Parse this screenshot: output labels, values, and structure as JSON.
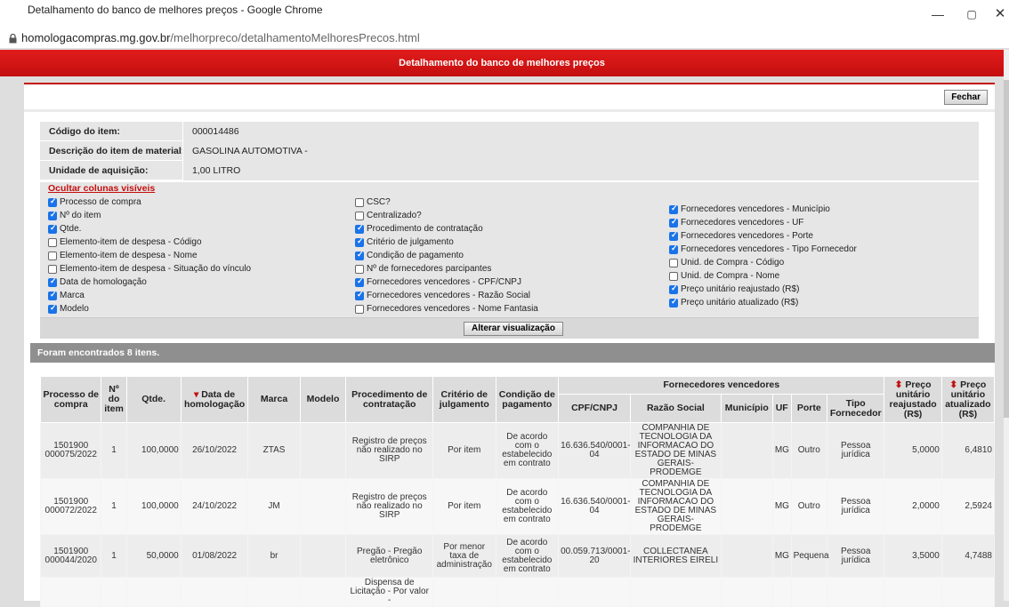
{
  "window": {
    "title": "Detalhamento do banco de melhores preços - Google Chrome",
    "min": "—",
    "max": "▢",
    "close": "✕"
  },
  "url": {
    "host": "homologacompras.mg.gov.br",
    "path": "/melhorpreco/detalhamentoMelhoresPrecos.html"
  },
  "header": {
    "title": "Detalhamento do banco de melhores preços",
    "close_label": "Fechar"
  },
  "info": [
    {
      "label": "Código do item:",
      "value": "000014486"
    },
    {
      "label": "Descrição do item de material:",
      "value": "GASOLINA AUTOMOTIVA -"
    },
    {
      "label": "Unidade de aquisição:",
      "value": "1,00 LITRO"
    }
  ],
  "columns_panel": {
    "title": "Ocultar colunas visíveis",
    "col1": [
      {
        "label": "Processo de compra",
        "checked": true
      },
      {
        "label": "Nº do item",
        "checked": true
      },
      {
        "label": "Qtde.",
        "checked": true
      },
      {
        "label": "Elemento-item de despesa - Código",
        "checked": false
      },
      {
        "label": "Elemento-item de despesa - Nome",
        "checked": false
      },
      {
        "label": "Elemento-item de despesa - Situação do vínculo",
        "checked": false
      },
      {
        "label": "Data de homologação",
        "checked": true
      },
      {
        "label": "Marca",
        "checked": true
      },
      {
        "label": "Modelo",
        "checked": true
      }
    ],
    "col2": [
      {
        "label": "CSC?",
        "checked": false
      },
      {
        "label": "Centralizado?",
        "checked": false
      },
      {
        "label": "Procedimento de contratação",
        "checked": true
      },
      {
        "label": "Critério de julgamento",
        "checked": true
      },
      {
        "label": "Condição de pagamento",
        "checked": true
      },
      {
        "label": " Nº de fornecedores parcipantes",
        "checked": false
      },
      {
        "label": "Fornecedores vencedores - CPF/CNPJ",
        "checked": true
      },
      {
        "label": "Fornecedores vencedores - Razão Social",
        "checked": true
      },
      {
        "label": "Fornecedores vencedores - Nome Fantasia",
        "checked": false
      }
    ],
    "col3": [
      {
        "label": "Fornecedores vencedores - Município",
        "checked": true
      },
      {
        "label": "Fornecedores vencedores - UF",
        "checked": true
      },
      {
        "label": "Fornecedores vencedores - Porte",
        "checked": true
      },
      {
        "label": "Fornecedores vencedores - Tipo Fornecedor",
        "checked": true
      },
      {
        "label": "Unid. de Compra - Código",
        "checked": false
      },
      {
        "label": "Unid. de Compra - Nome",
        "checked": false
      },
      {
        "label": "Preço unitário reajustado (R$)",
        "checked": true
      },
      {
        "label": "Preço unitário atualizado (R$)",
        "checked": true
      }
    ],
    "apply_label": "Alterar visualização"
  },
  "results": {
    "count_text": "Foram encontrados 8 itens.",
    "headers": {
      "processo": "Processo de compra",
      "num_item": "Nº do item",
      "qtde": "Qtde.",
      "data": "Data de homologação",
      "data_arrow": "▾",
      "marca": "Marca",
      "modelo": "Modelo",
      "procedimento": "Procedimento de contratação",
      "criterio": "Critério de julgamento",
      "condicao": "Condição de pagamento",
      "fornecedores": "Fornecedores vencedores",
      "cpf": "CPF/CNPJ",
      "razao": "Razão Social",
      "municipio": "Município",
      "uf": "UF",
      "porte": "Porte",
      "tipo": "Tipo Fornecedor",
      "sort_icon": "⬍",
      "preco_reaj": "Preço unitário reajustado (R$)",
      "preco_atual": "Preço unitário atualizado (R$)"
    },
    "rows": [
      {
        "processo": "1501900 000075/2022",
        "item": "1",
        "qtde": "100,0000",
        "data": "26/10/2022",
        "marca": "ZTAS",
        "modelo": "",
        "procedimento": "Registro de preços não realizado no SIRP",
        "criterio": "Por item",
        "condicao": "De acordo com o estabelecido em contrato",
        "cpf": "16.636.540/0001-04",
        "razao": "COMPANHIA DE TECNOLOGIA DA INFORMACAO DO ESTADO DE MINAS GERAIS-PRODEMGE",
        "municipio": "",
        "uf": "MG",
        "porte": "Outro",
        "tipo": "Pessoa jurídica",
        "reaj": "5,0000",
        "atual": "6,4810"
      },
      {
        "processo": "1501900 000072/2022",
        "item": "1",
        "qtde": "100,0000",
        "data": "24/10/2022",
        "marca": "JM",
        "modelo": "",
        "procedimento": "Registro de preços não realizado no SIRP",
        "criterio": "Por item",
        "condicao": "De acordo com o estabelecido em contrato",
        "cpf": "16.636.540/0001-04",
        "razao": "COMPANHIA DE TECNOLOGIA DA INFORMACAO DO ESTADO DE MINAS GERAIS-PRODEMGE",
        "municipio": "",
        "uf": "MG",
        "porte": "Outro",
        "tipo": "Pessoa jurídica",
        "reaj": "2,0000",
        "atual": "2,5924"
      },
      {
        "processo": "1501900 000044/2020",
        "item": "1",
        "qtde": "50,0000",
        "data": "01/08/2022",
        "marca": "br",
        "modelo": "",
        "procedimento": "Pregão - Pregão eletrônico",
        "criterio": "Por menor taxa de administração",
        "condicao": "De acordo com o estabelecido em contrato",
        "cpf": "00.059.713/0001-20",
        "razao": "COLLECTANEA INTERIORES EIRELI",
        "municipio": "",
        "uf": "MG",
        "porte": "Pequena",
        "tipo": "Pessoa jurídica",
        "reaj": "3,5000",
        "atual": "4,7488"
      },
      {
        "processo": "",
        "item": "",
        "qtde": "",
        "data": "",
        "marca": "",
        "modelo": "",
        "procedimento": "Dispensa de Licitação - Por valor -",
        "criterio": "",
        "condicao": "",
        "cpf": "",
        "razao": "",
        "municipio": "",
        "uf": "",
        "porte": "",
        "tipo": "",
        "reaj": "",
        "atual": ""
      }
    ]
  }
}
